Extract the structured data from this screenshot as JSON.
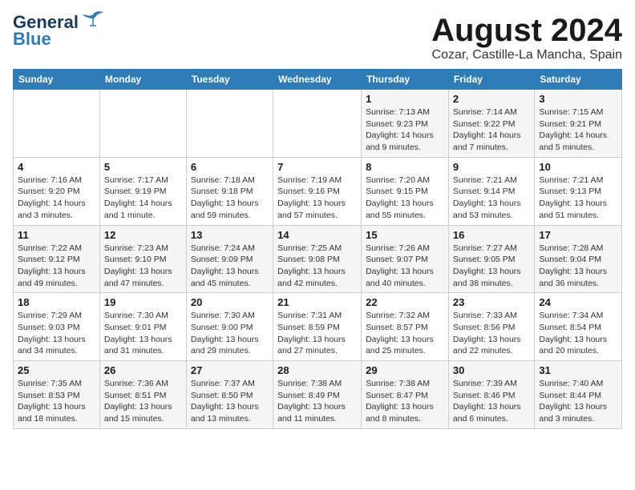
{
  "header": {
    "logo_line1": "General",
    "logo_line2": "Blue",
    "month_year": "August 2024",
    "location": "Cozar, Castille-La Mancha, Spain"
  },
  "weekdays": [
    "Sunday",
    "Monday",
    "Tuesday",
    "Wednesday",
    "Thursday",
    "Friday",
    "Saturday"
  ],
  "weeks": [
    [
      {
        "day": "",
        "info": ""
      },
      {
        "day": "",
        "info": ""
      },
      {
        "day": "",
        "info": ""
      },
      {
        "day": "",
        "info": ""
      },
      {
        "day": "1",
        "info": "Sunrise: 7:13 AM\nSunset: 9:23 PM\nDaylight: 14 hours\nand 9 minutes."
      },
      {
        "day": "2",
        "info": "Sunrise: 7:14 AM\nSunset: 9:22 PM\nDaylight: 14 hours\nand 7 minutes."
      },
      {
        "day": "3",
        "info": "Sunrise: 7:15 AM\nSunset: 9:21 PM\nDaylight: 14 hours\nand 5 minutes."
      }
    ],
    [
      {
        "day": "4",
        "info": "Sunrise: 7:16 AM\nSunset: 9:20 PM\nDaylight: 14 hours\nand 3 minutes."
      },
      {
        "day": "5",
        "info": "Sunrise: 7:17 AM\nSunset: 9:19 PM\nDaylight: 14 hours\nand 1 minute."
      },
      {
        "day": "6",
        "info": "Sunrise: 7:18 AM\nSunset: 9:18 PM\nDaylight: 13 hours\nand 59 minutes."
      },
      {
        "day": "7",
        "info": "Sunrise: 7:19 AM\nSunset: 9:16 PM\nDaylight: 13 hours\nand 57 minutes."
      },
      {
        "day": "8",
        "info": "Sunrise: 7:20 AM\nSunset: 9:15 PM\nDaylight: 13 hours\nand 55 minutes."
      },
      {
        "day": "9",
        "info": "Sunrise: 7:21 AM\nSunset: 9:14 PM\nDaylight: 13 hours\nand 53 minutes."
      },
      {
        "day": "10",
        "info": "Sunrise: 7:21 AM\nSunset: 9:13 PM\nDaylight: 13 hours\nand 51 minutes."
      }
    ],
    [
      {
        "day": "11",
        "info": "Sunrise: 7:22 AM\nSunset: 9:12 PM\nDaylight: 13 hours\nand 49 minutes."
      },
      {
        "day": "12",
        "info": "Sunrise: 7:23 AM\nSunset: 9:10 PM\nDaylight: 13 hours\nand 47 minutes."
      },
      {
        "day": "13",
        "info": "Sunrise: 7:24 AM\nSunset: 9:09 PM\nDaylight: 13 hours\nand 45 minutes."
      },
      {
        "day": "14",
        "info": "Sunrise: 7:25 AM\nSunset: 9:08 PM\nDaylight: 13 hours\nand 42 minutes."
      },
      {
        "day": "15",
        "info": "Sunrise: 7:26 AM\nSunset: 9:07 PM\nDaylight: 13 hours\nand 40 minutes."
      },
      {
        "day": "16",
        "info": "Sunrise: 7:27 AM\nSunset: 9:05 PM\nDaylight: 13 hours\nand 38 minutes."
      },
      {
        "day": "17",
        "info": "Sunrise: 7:28 AM\nSunset: 9:04 PM\nDaylight: 13 hours\nand 36 minutes."
      }
    ],
    [
      {
        "day": "18",
        "info": "Sunrise: 7:29 AM\nSunset: 9:03 PM\nDaylight: 13 hours\nand 34 minutes."
      },
      {
        "day": "19",
        "info": "Sunrise: 7:30 AM\nSunset: 9:01 PM\nDaylight: 13 hours\nand 31 minutes."
      },
      {
        "day": "20",
        "info": "Sunrise: 7:30 AM\nSunset: 9:00 PM\nDaylight: 13 hours\nand 29 minutes."
      },
      {
        "day": "21",
        "info": "Sunrise: 7:31 AM\nSunset: 8:59 PM\nDaylight: 13 hours\nand 27 minutes."
      },
      {
        "day": "22",
        "info": "Sunrise: 7:32 AM\nSunset: 8:57 PM\nDaylight: 13 hours\nand 25 minutes."
      },
      {
        "day": "23",
        "info": "Sunrise: 7:33 AM\nSunset: 8:56 PM\nDaylight: 13 hours\nand 22 minutes."
      },
      {
        "day": "24",
        "info": "Sunrise: 7:34 AM\nSunset: 8:54 PM\nDaylight: 13 hours\nand 20 minutes."
      }
    ],
    [
      {
        "day": "25",
        "info": "Sunrise: 7:35 AM\nSunset: 8:53 PM\nDaylight: 13 hours\nand 18 minutes."
      },
      {
        "day": "26",
        "info": "Sunrise: 7:36 AM\nSunset: 8:51 PM\nDaylight: 13 hours\nand 15 minutes."
      },
      {
        "day": "27",
        "info": "Sunrise: 7:37 AM\nSunset: 8:50 PM\nDaylight: 13 hours\nand 13 minutes."
      },
      {
        "day": "28",
        "info": "Sunrise: 7:38 AM\nSunset: 8:49 PM\nDaylight: 13 hours\nand 11 minutes."
      },
      {
        "day": "29",
        "info": "Sunrise: 7:38 AM\nSunset: 8:47 PM\nDaylight: 13 hours\nand 8 minutes."
      },
      {
        "day": "30",
        "info": "Sunrise: 7:39 AM\nSunset: 8:46 PM\nDaylight: 13 hours\nand 6 minutes."
      },
      {
        "day": "31",
        "info": "Sunrise: 7:40 AM\nSunset: 8:44 PM\nDaylight: 13 hours\nand 3 minutes."
      }
    ]
  ]
}
